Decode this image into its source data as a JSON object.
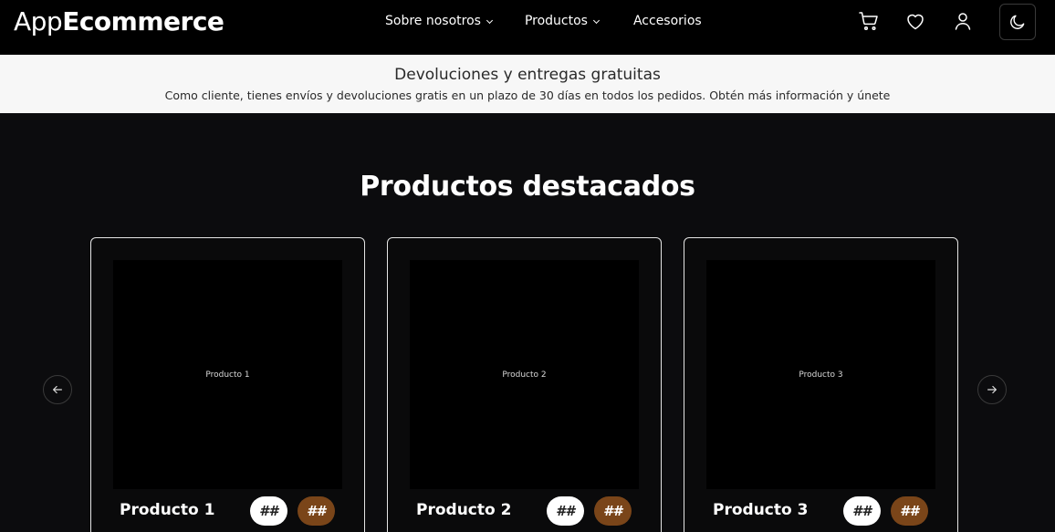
{
  "header": {
    "logo_light": "App",
    "logo_bold": "Ecommerce",
    "nav": [
      {
        "label": "Sobre nosotros"
      },
      {
        "label": "Productos"
      },
      {
        "label": "Accesorios"
      }
    ],
    "icons": [
      "cart-icon",
      "heart-icon",
      "user-icon",
      "moon-icon"
    ]
  },
  "promo": {
    "title": "Devoluciones y entregas gratuitas",
    "text": "Como cliente, tienes envíos y devoluciones gratis en un plazo de 30 días en todos los pedidos. Obtén más información y únete"
  },
  "featured": {
    "title": "Productos destacados",
    "products": [
      {
        "image_label": "Producto 1",
        "name": "Producto 1",
        "badge_1": "##",
        "badge_2": "##"
      },
      {
        "image_label": "Producto 2",
        "name": "Producto 2",
        "badge_1": "##",
        "badge_2": "##"
      },
      {
        "image_label": "Producto 3",
        "name": "Producto 3",
        "badge_1": "##",
        "badge_2": "##"
      }
    ]
  },
  "colors": {
    "background": "#0c0c0e",
    "header": "#000000",
    "promo_bg": "#f7f7f7",
    "badge_light": "#ffffff",
    "badge_brown": "#7a4519"
  }
}
